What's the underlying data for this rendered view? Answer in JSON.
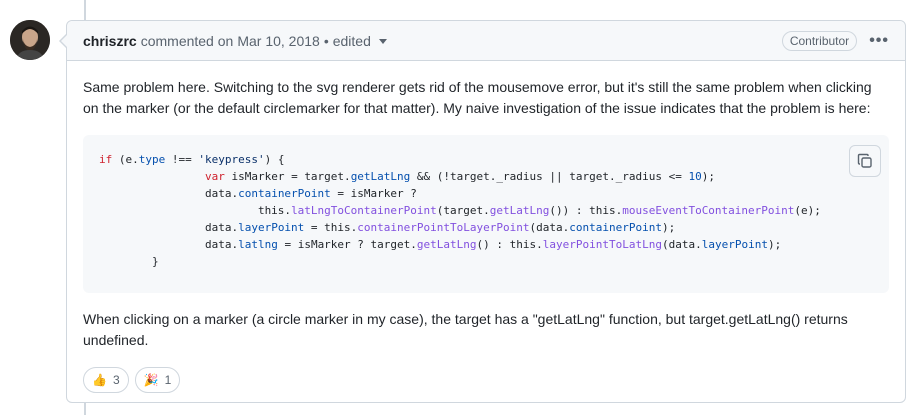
{
  "comment": {
    "author": "chriszrc",
    "action": "commented on",
    "date": "Mar 10, 2018",
    "separator": "•",
    "edited": "edited",
    "role_badge": "Contributor",
    "more_menu": "•••",
    "body_para1": "Same problem here. Switching to the svg renderer gets rid of the mousemove error, but it's still the same problem when clicking on the marker (or the default circlemarker for that matter). My naive investigation of the issue indicates that the problem is here:",
    "body_para2": "When clicking on a marker (a circle marker in my case), the target has a \"getLatLng\" function, but target.getLatLng() returns undefined.",
    "code_lines": [
      "if (e.type !== 'keypress') {",
      "                var isMarker = target.getLatLng && (!target._radius || target._radius <= 10);",
      "                data.containerPoint = isMarker ?",
      "                        this.latLngToContainerPoint(target.getLatLng()) : this.mouseEventToContainerPoint(e);",
      "                data.layerPoint = this.containerPointToLayerPoint(data.containerPoint);",
      "                data.latlng = isMarker ? target.getLatLng() : this.layerPointToLatLng(data.layerPoint);",
      "        }"
    ],
    "reactions": [
      {
        "emoji": "👍",
        "count": "3"
      },
      {
        "emoji": "🎉",
        "count": "1"
      }
    ]
  }
}
